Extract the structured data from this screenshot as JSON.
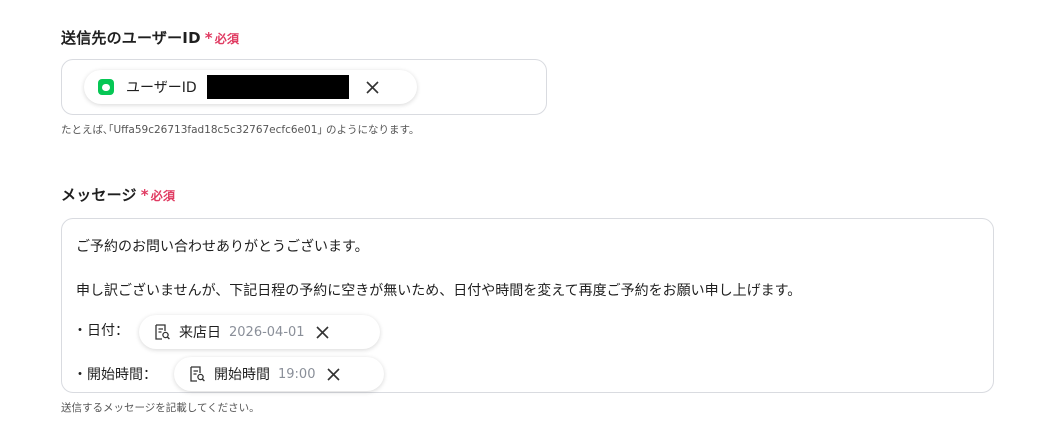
{
  "recipient": {
    "label": "送信先のユーザーID",
    "required_mark": "*",
    "required_text": "必須",
    "chip": {
      "icon": "line-icon",
      "label": "ユーザーID"
    },
    "hint": "たとえば､｢Uffa59c26713fad18c5c32767ecfc6e01｣ のようになります。"
  },
  "message": {
    "label": "メッセージ",
    "required_mark": "*",
    "required_text": "必須",
    "line1": "ご予約のお問い合わせありがとうございます。",
    "line2": "申し訳ございませんが、下記日程の予約に空きが無いため、日付や時間を変えて再度ご予約をお願い申し上げます。",
    "date_prefix": "・日付：",
    "date_chip": {
      "icon": "doc-search-icon",
      "label": "来店日",
      "value": "2026-04-01"
    },
    "time_prefix": "・開始時間：",
    "time_chip": {
      "icon": "doc-search-icon",
      "label": "開始時間",
      "value": "19:00"
    },
    "hint": "送信するメッセージを記載してください。"
  },
  "colors": {
    "required": "#e03b62",
    "line_green": "#06c755",
    "border": "#d9dbe0"
  }
}
